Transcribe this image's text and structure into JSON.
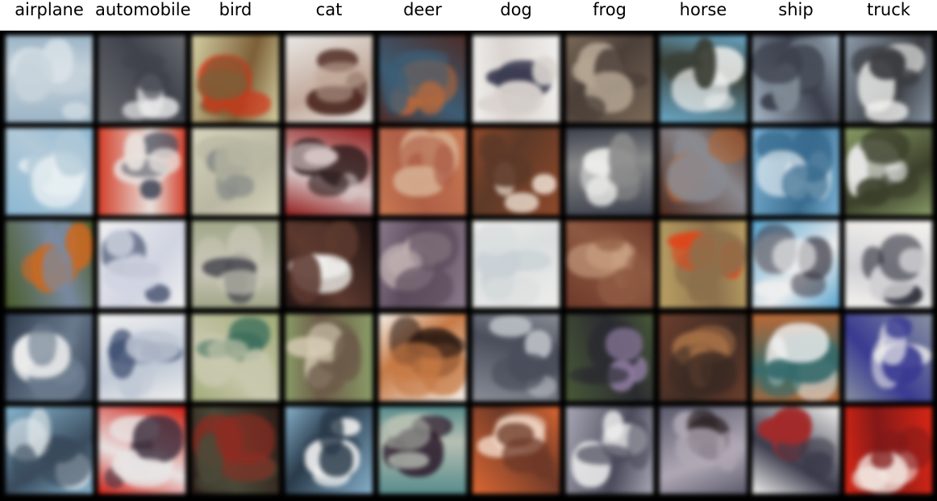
{
  "labels": [
    "airplane",
    "automobile",
    "bird",
    "cat",
    "deer",
    "dog",
    "frog",
    "horse",
    "ship",
    "truck"
  ],
  "rows": 5,
  "tile_palettes": [
    [
      [
        "#9db4c4",
        "#dfe6ea",
        "#c8d3da"
      ],
      [
        "#6a6c70",
        "#e8e8ea",
        "#3f424a"
      ],
      [
        "#d4d0a8",
        "#c7351c",
        "#7a5e3a"
      ],
      [
        "#e9e8e6",
        "#4a2a22",
        "#bfa89b"
      ],
      [
        "#4a2c28",
        "#b46a40",
        "#3f5d73"
      ],
      [
        "#f1f0ee",
        "#3b3c50",
        "#d9d3cf"
      ],
      [
        "#7a6a5a",
        "#b2a494",
        "#4a3f3a"
      ],
      [
        "#6fa7c4",
        "#eef0ee",
        "#3a3f36"
      ],
      [
        "#a9b9c6",
        "#7f8a94",
        "#3b3e4a"
      ],
      [
        "#8d9aa8",
        "#f2f2f0",
        "#3a3c40"
      ]
    ],
    [
      [
        "#8eb6cf",
        "#eef3f5",
        "#b3c9d6"
      ],
      [
        "#c8412e",
        "#4a4f5e",
        "#e8e2de"
      ],
      [
        "#d6d4bd",
        "#8a8e8a",
        "#b9b7a4"
      ],
      [
        "#8a1f1f",
        "#2a1a1a",
        "#d6c6c6"
      ],
      [
        "#c47a56",
        "#d4b296",
        "#a8604a"
      ],
      [
        "#8a4a2e",
        "#e9dcd0",
        "#5a3a2a"
      ],
      [
        "#3b3f4a",
        "#eeeeec",
        "#8a8a8a"
      ],
      [
        "#4c2a1e",
        "#b36a3a",
        "#8a8a90"
      ],
      [
        "#7fb0cf",
        "#eef3f5",
        "#3c6a8a"
      ],
      [
        "#8a9a6a",
        "#eaeaea",
        "#3a3f2c"
      ]
    ],
    [
      [
        "#4a5a2c",
        "#c46a28",
        "#7a8aa0"
      ],
      [
        "#f0f0f0",
        "#4c5670",
        "#d0d4e0"
      ],
      [
        "#a0a68a",
        "#4a4a52",
        "#c8c6b8"
      ],
      [
        "#1e1212",
        "#f2f2f0",
        "#5a3a30"
      ],
      [
        "#8a7a8a",
        "#c4b6b6",
        "#5a4a5a"
      ],
      [
        "#eeeeec",
        "#c8d0d4",
        "#dadede"
      ],
      [
        "#6a3a2c",
        "#c4a084",
        "#8a5a44"
      ],
      [
        "#b8a06a",
        "#d24a22",
        "#8a7050"
      ],
      [
        "#5aa0c8",
        "#3c3a44",
        "#eeeeee"
      ],
      [
        "#f6f4f0",
        "#2a2a36",
        "#d0d0d4"
      ]
    ],
    [
      [
        "#2e3a4a",
        "#eeeeee",
        "#6a7a8a"
      ],
      [
        "#f0f0f0",
        "#3a4a6a",
        "#c0c8d4"
      ],
      [
        "#a0aa7a",
        "#3a6a5a",
        "#c8c8b0"
      ],
      [
        "#8a9a6a",
        "#d6cdb8",
        "#6a5a4a"
      ],
      [
        "#f4f0ea",
        "#2a1a14",
        "#c07a4a"
      ],
      [
        "#8a8e96",
        "#c0c4c8",
        "#4a4e5a"
      ],
      [
        "#4a5a3a",
        "#8a7a9a",
        "#2a2a30"
      ],
      [
        "#6a4030",
        "#a0704a",
        "#3a2a24"
      ],
      [
        "#b86a3a",
        "#eeeeee",
        "#3a6a6a"
      ],
      [
        "#8a92a0",
        "#f0f0ee",
        "#3a3a8a"
      ]
    ],
    [
      [
        "#8ab4cc",
        "#e6ecee",
        "#3a4a5a"
      ],
      [
        "#c42218",
        "#3a2c3a",
        "#e8e4e4"
      ],
      [
        "#2a1c18",
        "#8a2c24",
        "#4a4a3a"
      ],
      [
        "#8ab0c8",
        "#f0f0f0",
        "#2a3a48"
      ],
      [
        "#5a8a8a",
        "#2a1a2a",
        "#b8c0b4"
      ],
      [
        "#d46a3a",
        "#f0d8c8",
        "#6a3a2a"
      ],
      [
        "#a8a8b4",
        "#eeeeee",
        "#4a4a5a"
      ],
      [
        "#5a5a6a",
        "#2a2224",
        "#b0a8b4"
      ],
      [
        "#f2f2f0",
        "#9a2c2c",
        "#3a3a4a"
      ],
      [
        "#cc2a1a",
        "#f4ece6",
        "#7a1a1a"
      ]
    ]
  ]
}
